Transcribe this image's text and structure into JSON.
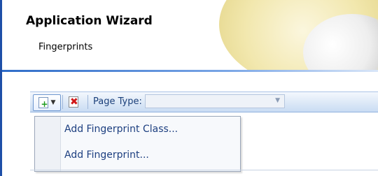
{
  "header": {
    "title": "Application Wizard",
    "subtitle": "Fingerprints"
  },
  "toolbar": {
    "page_type_label": "Page Type:",
    "page_type_value": "",
    "icons": {
      "add": "add-page-icon",
      "dropdown": "chevron-down-icon",
      "delete": "delete-icon"
    }
  },
  "menu": {
    "items": [
      {
        "label": "Add Fingerprint Class..."
      },
      {
        "label": "Add Fingerprint..."
      }
    ]
  },
  "colors": {
    "left_border": "#1e4fa8",
    "toolbar_bg": "#dce8f7",
    "menu_text": "#1d3f80"
  }
}
